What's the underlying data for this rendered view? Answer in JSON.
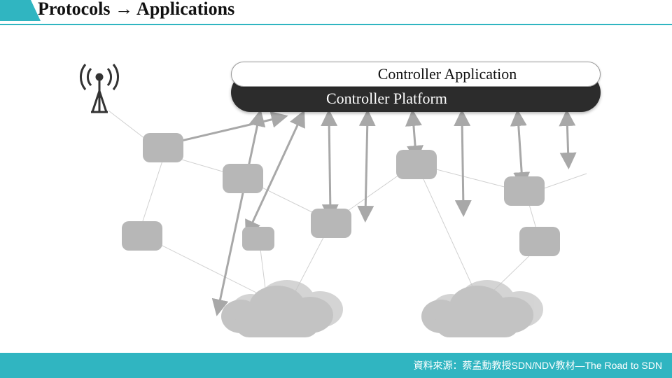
{
  "title": "Protocols → Applications",
  "controller": {
    "app_label": "Controller Application",
    "platform_label": "Controller Platform"
  },
  "footer": {
    "credit": "資料來源：蔡孟勳教授SDN/NDV教材—The Road to SDN"
  },
  "diagram": {
    "icons": {
      "antenna": "wireless-antenna-icon",
      "node": "router-node-icon",
      "cloud": "network-cloud-icon"
    },
    "network_nodes_count": 8,
    "clouds_count": 2,
    "theme": {
      "accent": "#30b5c1",
      "node_fill": "#b7b7b7",
      "cloud_fill": "#c3c3c3",
      "platform_bg": "#2c2c2c"
    }
  }
}
